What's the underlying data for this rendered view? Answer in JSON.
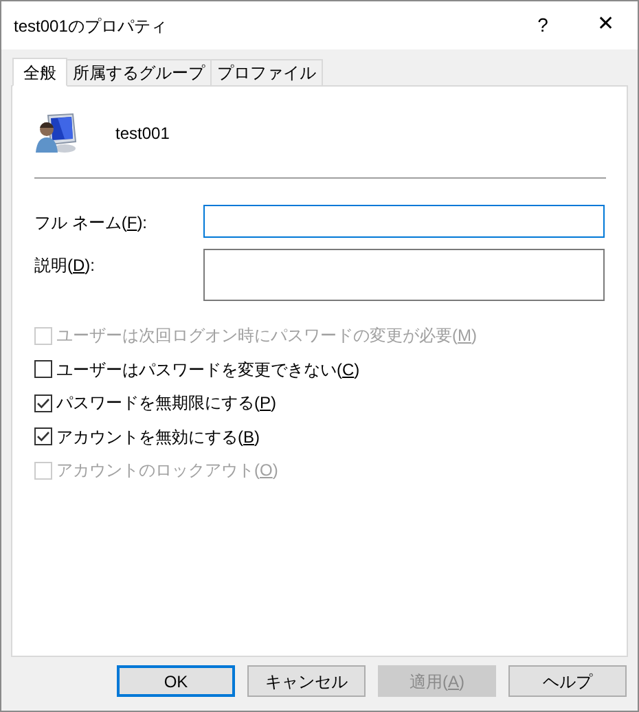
{
  "window": {
    "title": "test001のプロパティ",
    "help_glyph": "?",
    "close_glyph": "✕"
  },
  "tabs": [
    {
      "label": "全般",
      "selected": true
    },
    {
      "label": "所属するグループ",
      "selected": false
    },
    {
      "label": "プロファイル",
      "selected": false
    }
  ],
  "user": {
    "name": "test001"
  },
  "fields": [
    {
      "before": "フル ネーム(",
      "mnemonic": "F",
      "after": "):",
      "focused": true,
      "kind": "single"
    },
    {
      "before": "説明(",
      "mnemonic": "D",
      "after": "):",
      "focused": false,
      "kind": "multi"
    }
  ],
  "options": [
    {
      "before": "ユーザーは次回ログオン時にパスワードの変更が必要(",
      "mnemonic": "M",
      "after": ")",
      "checked": false,
      "disabled": true
    },
    {
      "before": "ユーザーはパスワードを変更できない(",
      "mnemonic": "C",
      "after": ")",
      "checked": false,
      "disabled": false
    },
    {
      "before": "パスワードを無期限にする(",
      "mnemonic": "P",
      "after": ")",
      "checked": true,
      "disabled": false
    },
    {
      "before": "アカウントを無効にする(",
      "mnemonic": "B",
      "after": ")",
      "checked": true,
      "disabled": false
    },
    {
      "before": "アカウントのロックアウト(",
      "mnemonic": "O",
      "after": ")",
      "checked": false,
      "disabled": true
    }
  ],
  "buttons": [
    {
      "before": "OK",
      "default": true,
      "disabled": false
    },
    {
      "before": "キャンセル",
      "default": false,
      "disabled": false
    },
    {
      "before": "適用(",
      "mnemonic": "A",
      "after": ")",
      "default": false,
      "disabled": true
    },
    {
      "before": "ヘルプ",
      "default": false,
      "disabled": false
    }
  ]
}
